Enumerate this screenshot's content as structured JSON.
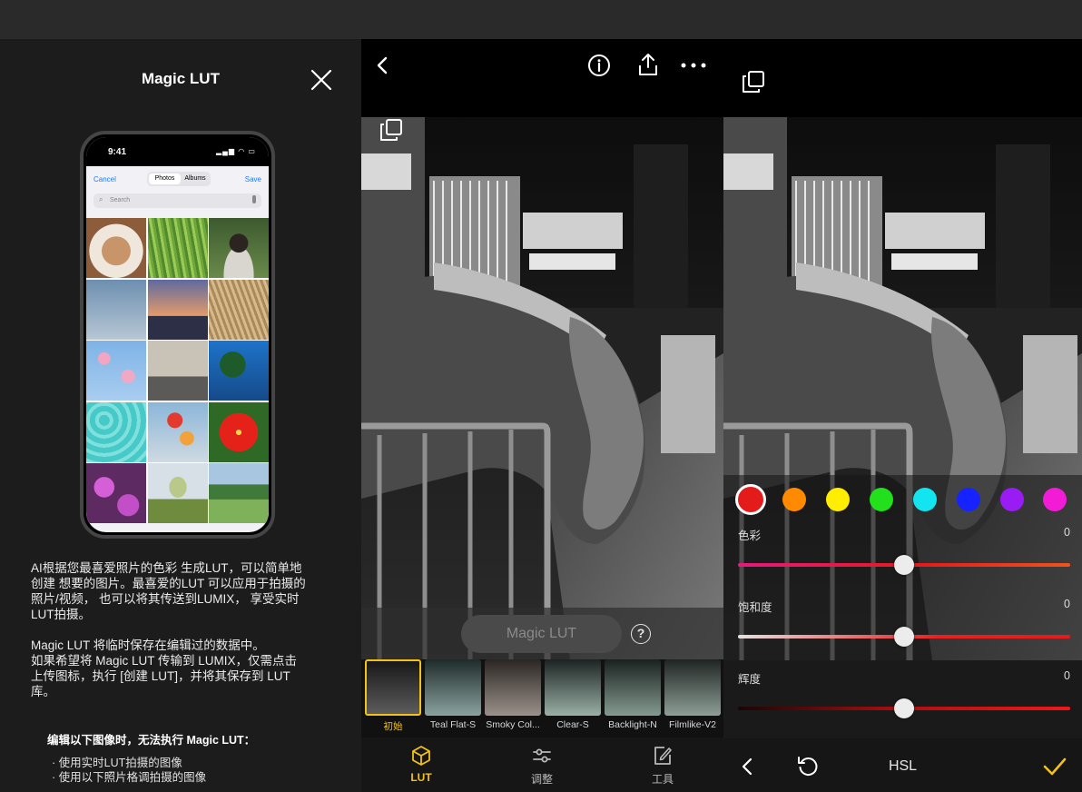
{
  "panel1": {
    "title": "Magic LUT",
    "phone": {
      "time": "9:41",
      "cancel": "Cancel",
      "segment_photos": "Photos",
      "segment_albums": "Albums",
      "save": "Save",
      "search_placeholder": "Search"
    },
    "description": "AI根据您最喜爱照片的色彩 生成LUT，可以简单地\n创建 想要的图片。最喜爱的LUT 可以应用于拍摄的\n照片/视频， 也可以将其传送到LUMIX， 享受实时\nLUT拍摄。\n\nMagic LUT 将临时保存在编辑过的数据中。\n如果希望将 Magic LUT 传输到 LUMIX，仅需点击\n上传图标，执行 [创建 LUT]，并将其保存到 LUT\n库。",
    "warning_title": "编辑以下图像时，无法执行 Magic LUT：",
    "bullets": [
      "· 使用实时LUT拍摄的图像",
      "· 使用以下照片格调拍摄的图像"
    ]
  },
  "panel2": {
    "magic_lut_button": "Magic LUT",
    "help_symbol": "?",
    "luts": [
      {
        "label": "初始",
        "selected": true
      },
      {
        "label": "Teal Flat-S",
        "selected": false
      },
      {
        "label": "Smoky Col...",
        "selected": false
      },
      {
        "label": "Clear-S",
        "selected": false
      },
      {
        "label": "Backlight-N",
        "selected": false
      },
      {
        "label": "Filmlike-V2",
        "selected": false
      }
    ],
    "tabs": [
      {
        "label": "LUT",
        "icon": "cube-icon",
        "active": true
      },
      {
        "label": "调整",
        "icon": "sliders-icon",
        "active": false
      },
      {
        "label": "工具",
        "icon": "edit-icon",
        "active": false
      }
    ],
    "accent_color": "#f2c21b"
  },
  "panel3": {
    "hsl_colors": [
      "#e31b1b",
      "#ff8a00",
      "#ffee00",
      "#22e01c",
      "#12e4f0",
      "#1622ff",
      "#9a1cf4",
      "#f21cd6"
    ],
    "selected_color_index": 0,
    "sliders": [
      {
        "label": "色彩",
        "value": "0",
        "level": 0.5
      },
      {
        "label": "饱和度",
        "value": "0",
        "level": 0.5
      },
      {
        "label": "辉度",
        "value": "0",
        "level": 0.5
      }
    ],
    "bottom_title": "HSL"
  }
}
